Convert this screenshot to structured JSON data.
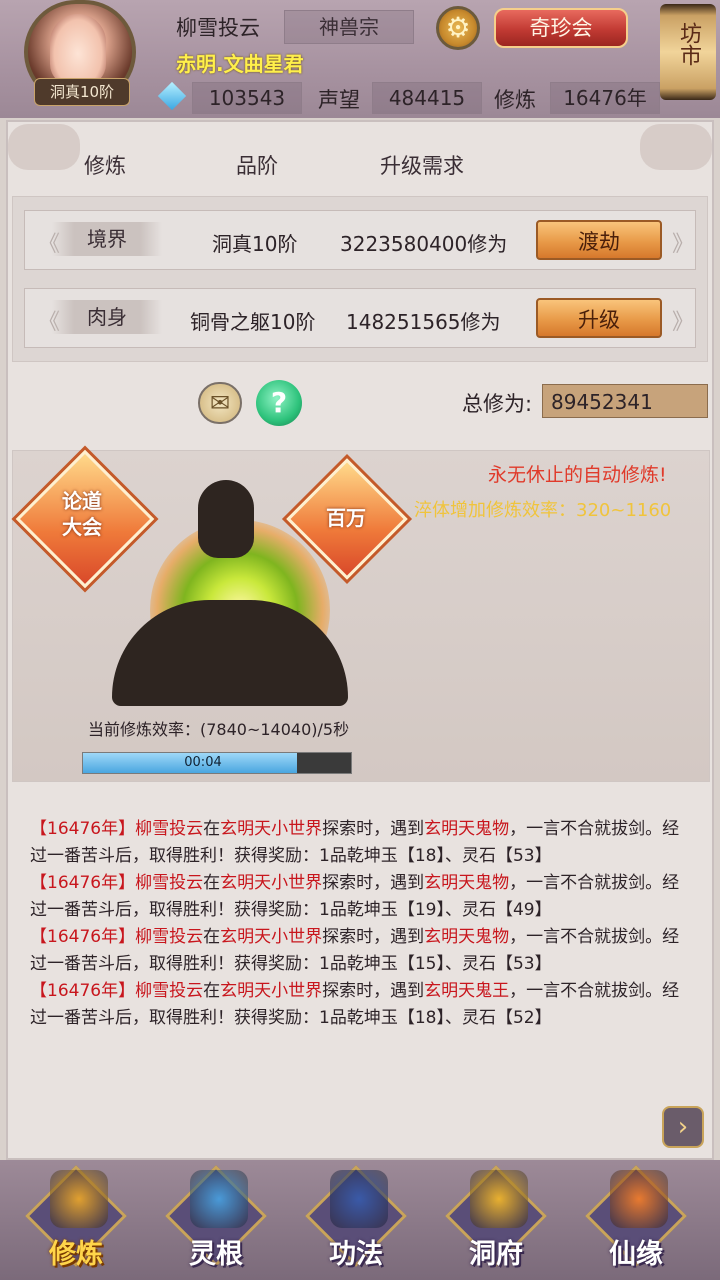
{
  "header": {
    "player_name": "柳雪投云",
    "sect": "神兽宗",
    "title": "赤明.文曲星君",
    "rank_badge": "洞真10阶",
    "treasure_button": "奇珍会",
    "market_button": "坊市",
    "stats": {
      "spirit_stones": "103543",
      "reputation_label": "声望",
      "reputation": "484415",
      "cultivation_label": "修炼",
      "cultivation_years": "16476年"
    }
  },
  "columns": {
    "c1": "修炼",
    "c2": "品阶",
    "c3": "升级需求"
  },
  "rows": [
    {
      "tag": "境界",
      "grade": "洞真10阶",
      "requirement": "3223580400修为",
      "action": "渡劫"
    },
    {
      "tag": "肉身",
      "grade": "铜骨之躯10阶",
      "requirement": "148251565修为",
      "action": "升级"
    }
  ],
  "total": {
    "label": "总修为:",
    "value": "89452341"
  },
  "cultivation": {
    "left_badge": "论道\n大会",
    "right_badge": "百万",
    "endless": "永无休止的自动修炼!",
    "boost": "淬体增加修炼效率：320~1160",
    "rate": "当前修炼效率：(7840~14040)/5秒",
    "timer": "00:04",
    "progress_fraction": 0.8
  },
  "log": [
    {
      "year": "【16476年】",
      "name": "柳雪投云",
      "t1": "在",
      "place": "玄明天小世界",
      "t2": "探索时，遇到",
      "enemy": "玄明天鬼物",
      "t3": "，一言不合就拔剑。经过一番苦斗后，取得胜利！获得奖励：1品乾坤玉【18】、灵石【53】"
    },
    {
      "year": "【16476年】",
      "name": "柳雪投云",
      "t1": "在",
      "place": "玄明天小世界",
      "t2": "探索时，遇到",
      "enemy": "玄明天鬼物",
      "t3": "，一言不合就拔剑。经过一番苦斗后，取得胜利！获得奖励：1品乾坤玉【19】、灵石【49】"
    },
    {
      "year": "【16476年】",
      "name": "柳雪投云",
      "t1": "在",
      "place": "玄明天小世界",
      "t2": "探索时，遇到",
      "enemy": "玄明天鬼物",
      "t3": "，一言不合就拔剑。经过一番苦斗后，取得胜利！获得奖励：1品乾坤玉【15】、灵石【53】"
    },
    {
      "year": "【16476年】",
      "name": "柳雪投云",
      "t1": "在",
      "place": "玄明天小世界",
      "t2": "探索时，遇到",
      "enemy": "玄明天鬼王",
      "t3": "，一言不合就拔剑。经过一番苦斗后，取得胜利！获得奖励：1品乾坤玉【18】、灵石【52】"
    }
  ],
  "nav": [
    {
      "label": "修炼",
      "icon": "cultivate-icon",
      "color": "#e0a030"
    },
    {
      "label": "灵根",
      "icon": "spirit-root-icon",
      "color": "#4a9ad8"
    },
    {
      "label": "功法",
      "icon": "manual-icon",
      "color": "#3a5aa8"
    },
    {
      "label": "洞府",
      "icon": "cave-icon",
      "color": "#e8b030"
    },
    {
      "label": "仙缘",
      "icon": "gourd-icon",
      "color": "#e87a30"
    }
  ],
  "colors": {
    "accent_red": "#c8161d",
    "gold_text": "#f0c43c",
    "button_orange": "#e89a48"
  }
}
